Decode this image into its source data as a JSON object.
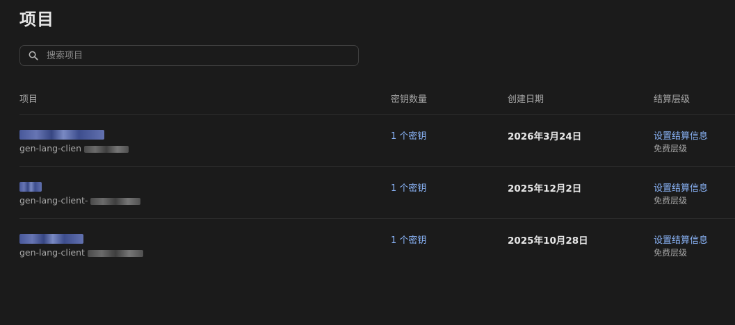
{
  "page": {
    "title": "项目"
  },
  "search": {
    "placeholder": "搜索项目",
    "value": ""
  },
  "table": {
    "headers": {
      "project": "项目",
      "keys": "密钥数量",
      "created": "创建日期",
      "billing": "结算层级"
    },
    "rows": [
      {
        "id_prefix": "gen-lang-clien",
        "keys": "1 个密钥",
        "created": "2026年3月24日",
        "billing_link": "设置结算信息",
        "tier": "免费层级"
      },
      {
        "id_prefix": "gen-lang-client-",
        "keys": "1 个密钥",
        "created": "2025年12月2日",
        "billing_link": "设置结算信息",
        "tier": "免费层级"
      },
      {
        "id_prefix": "gen-lang-client",
        "keys": "1 个密钥",
        "created": "2025年10月28日",
        "billing_link": "设置结算信息",
        "tier": "免费层级"
      }
    ]
  },
  "colors": {
    "background": "#1b1b1b",
    "link": "#8ab4f8",
    "divider": "#2d2d2d"
  },
  "icons": {
    "search": "search-icon"
  }
}
